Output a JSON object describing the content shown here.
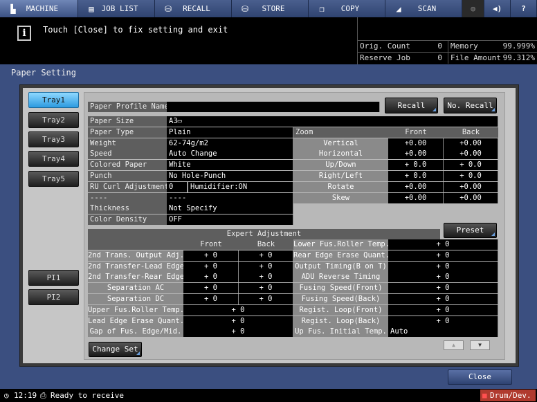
{
  "nav": [
    {
      "label": "MACHINE",
      "icon": "machine-icon",
      "glyph": "▙"
    },
    {
      "label": "JOB LIST",
      "icon": "list-icon",
      "glyph": "▤"
    },
    {
      "label": "RECALL",
      "icon": "recall-icon",
      "glyph": "⛁"
    },
    {
      "label": "STORE",
      "icon": "store-icon",
      "glyph": "⛁"
    },
    {
      "label": "COPY",
      "icon": "copy-icon",
      "glyph": "❐"
    },
    {
      "label": "SCAN",
      "icon": "scan-icon",
      "glyph": "◢"
    }
  ],
  "nav_icons": {
    "globe": "◍",
    "sound": "◀)",
    "help": "?"
  },
  "message": "Touch [Close] to fix setting and exit",
  "info_glyph": "i",
  "counters": {
    "orig_count_label": "Orig. Count",
    "orig_count": "0",
    "memory_label": "Memory",
    "memory": "99.999%",
    "reserve_job_label": "Reserve Job",
    "reserve_job": "0",
    "file_amount_label": "File Amount",
    "file_amount": "99.312%"
  },
  "title": "Paper Setting",
  "trays": [
    "Tray1",
    "Tray2",
    "Tray3",
    "Tray4",
    "Tray5"
  ],
  "pi": [
    "PI1",
    "PI2"
  ],
  "profile": {
    "label": "Paper Profile Name",
    "value": "",
    "recall": "Recall",
    "no_recall": "No. Recall"
  },
  "paper": [
    {
      "label": "Paper Size",
      "value": "A3▭"
    },
    {
      "label": "Paper Type",
      "value": "Plain"
    },
    {
      "label": "Weight",
      "value": "62-74g/m2"
    },
    {
      "label": "Speed",
      "value": "Auto Change"
    },
    {
      "label": "Colored Paper",
      "value": "White"
    },
    {
      "label": "Punch",
      "value": "No Hole-Punch"
    },
    {
      "label": "RU Curl Adjustment",
      "value": "0",
      "extra": "Humidifier:ON"
    },
    {
      "label": "----",
      "value": "----"
    },
    {
      "label": "Thickness",
      "value": "Not Specify"
    },
    {
      "label": "Color Density",
      "value": "OFF"
    }
  ],
  "zoom": {
    "label": "Zoom",
    "front": "Front",
    "back": "Back",
    "rows": [
      {
        "label": "Vertical",
        "front": "+0.00",
        "back": "+0.00"
      },
      {
        "label": "Horizontal",
        "front": "+0.00",
        "back": "+0.00"
      },
      {
        "label": "Up/Down",
        "front": "+ 0.0",
        "back": "+ 0.0"
      },
      {
        "label": "Right/Left",
        "front": "+ 0.0",
        "back": "+ 0.0"
      },
      {
        "label": "Rotate",
        "front": "+0.00",
        "back": "+0.00"
      },
      {
        "label": "Skew",
        "front": "+0.00",
        "back": "+0.00"
      }
    ]
  },
  "expert": {
    "title": "Expert Adjustment",
    "preset": "Preset",
    "front": "Front",
    "back": "Back",
    "left": [
      {
        "label": "2nd Trans. Output Adj.",
        "front": "+  0",
        "back": "+  0"
      },
      {
        "label": "2nd Transfer-Lead Edge",
        "front": "+  0",
        "back": "+  0"
      },
      {
        "label": "2nd Transfer-Rear Edge",
        "front": "+  0",
        "back": "+  0"
      },
      {
        "label": "Separation AC",
        "front": "+  0",
        "back": "+  0"
      },
      {
        "label": "Separation DC",
        "front": "+  0",
        "back": "+  0"
      },
      {
        "label": "Upper Fus.Roller Temp.",
        "value": "+  0"
      },
      {
        "label": "Lead Edge Erase Quant.",
        "value": "+  0"
      },
      {
        "label": "Gap of Fus. Edge/Mid.",
        "value": "+  0"
      }
    ],
    "right": [
      {
        "label": "Lower Fus.Roller Temp.",
        "value": "+  0"
      },
      {
        "label": "Rear Edge Erase Quant.",
        "value": "+  0"
      },
      {
        "label": "Output Timing(B on T)",
        "value": "+  0"
      },
      {
        "label": "ADU Reverse Timing",
        "value": "+  0"
      },
      {
        "label": "Fusing Speed(Front)",
        "value": "+  0"
      },
      {
        "label": "Fusing Speed(Back)",
        "value": "+  0"
      },
      {
        "label": "Regist. Loop(Front)",
        "value": "+  0"
      },
      {
        "label": "Regist. Loop(Back)",
        "value": "+  0"
      },
      {
        "label": "Up Fus. Initial Temp.",
        "value": "Auto"
      }
    ]
  },
  "change_set": "Change Set",
  "scroll": {
    "up": "▲",
    "down": "▼"
  },
  "close": "Close",
  "status": {
    "time": "12:19",
    "text": "Ready to receive",
    "alert": "Drum/Dev."
  },
  "colors": {
    "accent": "#2d9be0",
    "background": "#3b4f80",
    "alert": "#c0392b"
  }
}
